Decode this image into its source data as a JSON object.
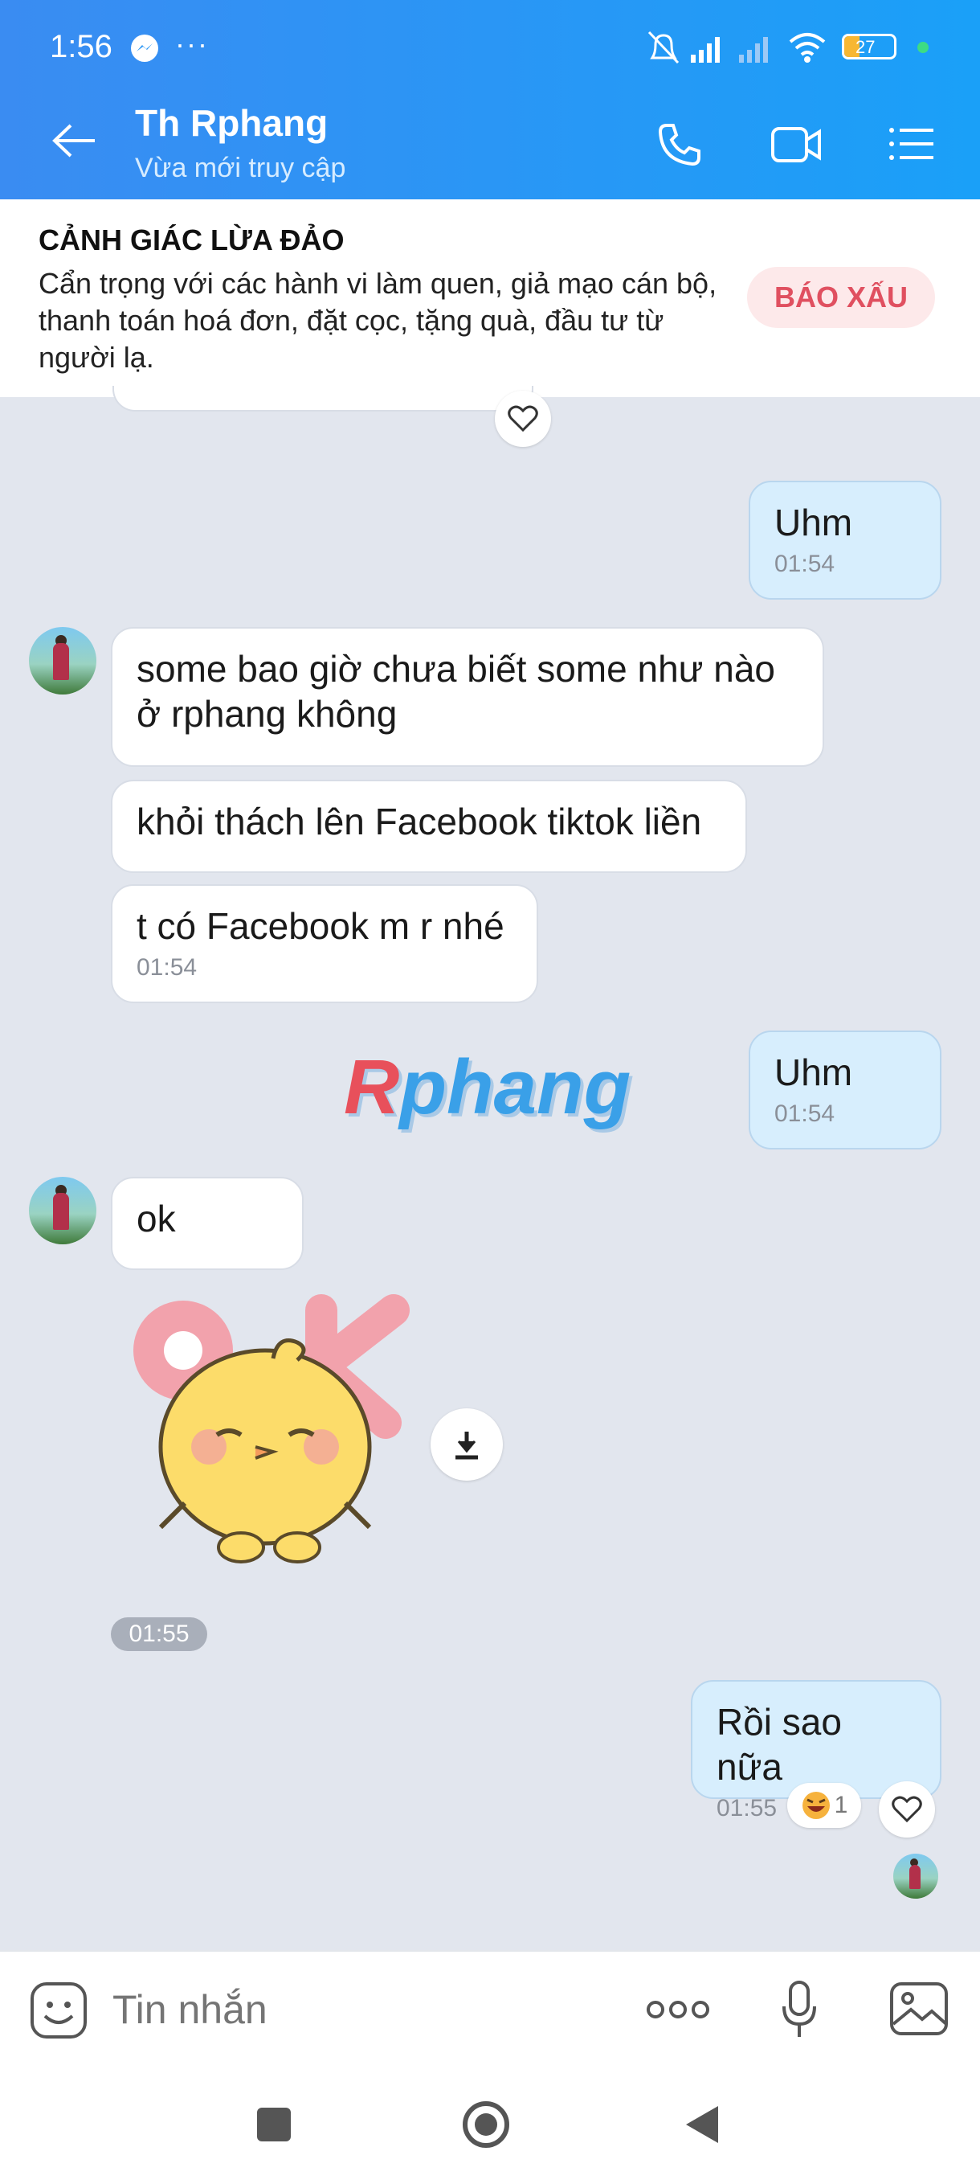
{
  "status_bar": {
    "time": "1:56",
    "battery": "27"
  },
  "header": {
    "title": "Th Rphang",
    "subtitle": "Vừa mới truy cập"
  },
  "warning": {
    "title": "CẢNH GIÁC LỪA ĐẢO",
    "text": "Cẩn trọng với các hành vi làm quen, giả mạo cán bộ, thanh toán hoá đơn, đặt cọc, tặng quà, đầu tư từ người lạ.",
    "report_label": "BÁO XẤU"
  },
  "messages": [
    {
      "dir": "out",
      "text": "Uhm",
      "time": "01:54"
    },
    {
      "dir": "in",
      "text": "some bao giờ chưa biết some như nào ở rphang không"
    },
    {
      "dir": "in",
      "text": "khỏi thách lên Facebook tiktok liền"
    },
    {
      "dir": "in",
      "text": "t có Facebook m r nhé",
      "time": "01:54"
    },
    {
      "dir": "out",
      "text": "Uhm",
      "time": "01:54"
    },
    {
      "dir": "in",
      "text": "ok"
    },
    {
      "dir": "in",
      "sticker": "ok-chick-sticker",
      "time": "01:55"
    },
    {
      "dir": "out",
      "text": "Rồi sao nữa",
      "time": "01:55",
      "reaction_count": "1"
    }
  ],
  "watermark": "Rphang",
  "composer": {
    "placeholder": "Tin nhắn"
  },
  "colors": {
    "header": "#2b96f5",
    "outgoing": "#d7eefd",
    "incoming": "#ffffff",
    "chat_bg": "#e2e6ee",
    "report": "#e05060"
  }
}
